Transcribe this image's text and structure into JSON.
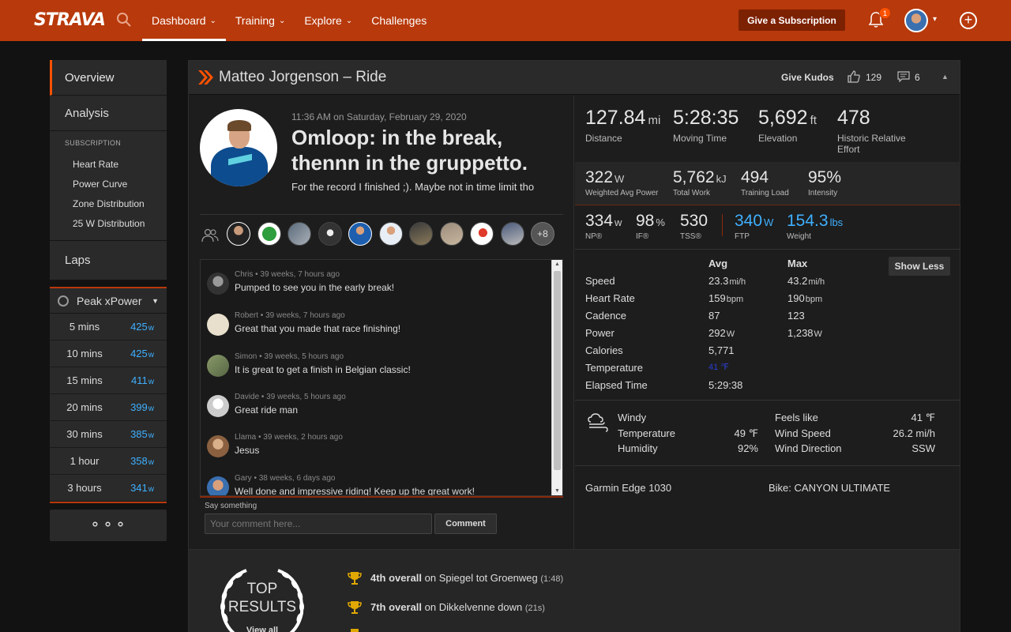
{
  "nav": {
    "logo": "STRAVA",
    "items": [
      {
        "label": "Dashboard",
        "chevron": "⌄"
      },
      {
        "label": "Training",
        "chevron": "⌄"
      },
      {
        "label": "Explore",
        "chevron": "⌄"
      },
      {
        "label": "Challenges",
        "chevron": ""
      }
    ],
    "gift_label": "Give a Subscription",
    "notification_count": "1",
    "accent": "#fc5200",
    "topbar_color": "#b8390b"
  },
  "sidebar": {
    "tabs": [
      "Overview",
      "Analysis"
    ],
    "subscription_header": "SUBSCRIPTION",
    "sub_links": [
      "Heart Rate",
      "Power Curve",
      "Zone Distribution",
      "25 W Distribution"
    ],
    "laps": "Laps",
    "peak_title": "Peak xPower",
    "peak_rows": [
      {
        "label": "5 mins",
        "value": "425",
        "unit": "w"
      },
      {
        "label": "10 mins",
        "value": "425",
        "unit": "w"
      },
      {
        "label": "15 mins",
        "value": "411",
        "unit": "w"
      },
      {
        "label": "20 mins",
        "value": "399",
        "unit": "w"
      },
      {
        "label": "30 mins",
        "value": "385",
        "unit": "w"
      },
      {
        "label": "1 hour",
        "value": "358",
        "unit": "w"
      },
      {
        "label": "3 hours",
        "value": "341",
        "unit": "w"
      }
    ],
    "more": "⚬⚬⚬"
  },
  "header": {
    "title": "Matteo Jorgenson – Ride",
    "give_kudos": "Give Kudos",
    "kudos_count": "129",
    "comment_count": "6",
    "collapse": "▲"
  },
  "activity": {
    "timestamp": "11:36 AM on Saturday, February 29, 2020",
    "name": "Omloop: in the break, thennn in the gruppetto.",
    "description": "For the record I finished ;). Maybe not in time limit tho",
    "group_more": "+8"
  },
  "comments": [
    {
      "meta": "Chris • 39 weeks, 7 hours ago",
      "text": "Pumped to see you in the early break!",
      "color": "#555"
    },
    {
      "meta": "Robert • 39 weeks, 7 hours ago",
      "text": "Great that you made that race finishing!",
      "color": "#e8e0cc"
    },
    {
      "meta": "Simon • 39 weeks, 5 hours ago",
      "text": "It is great to get a finish in Belgian classic!",
      "color": "#8a9a6a"
    },
    {
      "meta": "Davide • 39 weeks, 5 hours ago",
      "text": "Great ride man",
      "color": "#e0e0e0"
    },
    {
      "meta": "Llama • 39 weeks, 2 hours ago",
      "text": "Jesus",
      "color": "#b89060"
    },
    {
      "meta": "Gary • 38 weeks, 6 days ago",
      "text": "Well done and impressive riding! Keep up the great work!",
      "color": "#3a6fb0"
    }
  ],
  "comment_form": {
    "label": "Say something",
    "placeholder": "Your comment here...",
    "button": "Comment"
  },
  "stats_top": [
    {
      "value": "127.84",
      "unit": "mi",
      "label": "Distance"
    },
    {
      "value": "5:28:35",
      "unit": "",
      "label": "Moving Time"
    },
    {
      "value": "5,692",
      "unit": "ft",
      "label": "Elevation"
    },
    {
      "value": "478",
      "unit": "",
      "label": "Historic Relative Effort"
    }
  ],
  "stats_mid": [
    {
      "value": "322",
      "unit": "W",
      "label": "Weighted Avg Power"
    },
    {
      "value": "5,762",
      "unit": "kJ",
      "label": "Total Work"
    },
    {
      "value": "494",
      "unit": "",
      "label": "Training Load"
    },
    {
      "value": "95%",
      "unit": "",
      "label": "Intensity"
    }
  ],
  "stats_row3": [
    {
      "value": "334",
      "unit": "w",
      "label": "NP®"
    },
    {
      "value": "98",
      "unit": "%",
      "label": "IF®"
    },
    {
      "value": "530",
      "unit": "",
      "label": "TSS®"
    },
    {
      "value": "340",
      "unit": "W",
      "label": "FTP"
    },
    {
      "value": "154.3",
      "unit": "lbs",
      "label": "Weight"
    }
  ],
  "table": {
    "avg_header": "Avg",
    "max_header": "Max",
    "show_less": "Show Less",
    "rows": [
      {
        "label": "Speed",
        "avg": "23.3",
        "avg_unit": "mi/h",
        "max": "43.2",
        "max_unit": "mi/h"
      },
      {
        "label": "Heart Rate",
        "avg": "159",
        "avg_unit": "bpm",
        "max": "190",
        "max_unit": "bpm"
      },
      {
        "label": "Cadence",
        "avg": "87",
        "avg_unit": "",
        "max": "123",
        "max_unit": ""
      },
      {
        "label": "Power",
        "avg": "292",
        "avg_unit": "W",
        "max": "1,238",
        "max_unit": "W"
      },
      {
        "label": "Calories",
        "avg": "5,771",
        "avg_unit": "",
        "max": "",
        "max_unit": ""
      },
      {
        "label": "Temperature",
        "avg": "41 ℉",
        "avg_unit": "",
        "max": "",
        "max_unit": ""
      },
      {
        "label": "Elapsed Time",
        "avg": "5:29:38",
        "avg_unit": "",
        "max": "",
        "max_unit": ""
      }
    ]
  },
  "weather": {
    "condition": "Windy",
    "left": [
      {
        "label": "Temperature",
        "value": "49 ℉"
      },
      {
        "label": "Humidity",
        "value": "92%"
      }
    ],
    "right": [
      {
        "label": "Feels like",
        "value": "41 ℉"
      },
      {
        "label": "Wind Speed",
        "value": "26.2 mi/h"
      },
      {
        "label": "Wind Direction",
        "value": "SSW"
      }
    ]
  },
  "gear": {
    "device": "Garmin Edge 1030",
    "bike": "Bike: CANYON ULTIMATE"
  },
  "results": {
    "badge_line1": "TOP",
    "badge_line2": "RESULTS",
    "view_all": "View all",
    "items": [
      {
        "rank": "4th overall",
        "on": "on Spiegel tot Groenweg",
        "time": "(1:48)"
      },
      {
        "rank": "7th overall",
        "on": "on Dikkelvenne down",
        "time": "(21s)"
      }
    ]
  }
}
